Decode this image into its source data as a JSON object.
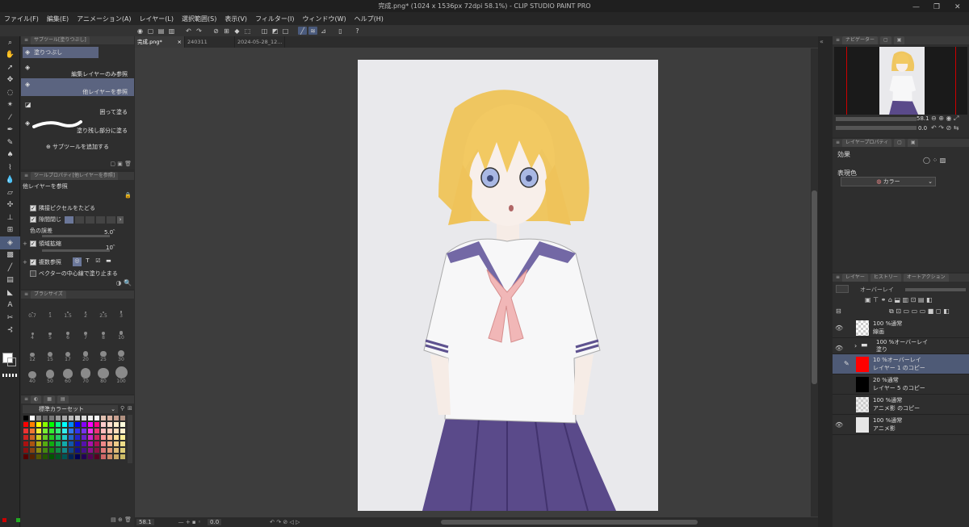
{
  "window": {
    "title": "完成.png* (1024 x 1536px 72dpi 58.1%) - CLIP STUDIO PAINT PRO",
    "min": "—",
    "max": "❐",
    "close": "✕"
  },
  "menu": [
    "ファイル(F)",
    "編集(E)",
    "アニメーション(A)",
    "レイヤー(L)",
    "選択範囲(S)",
    "表示(V)",
    "フィルター(I)",
    "ウィンドウ(W)",
    "ヘルプ(H)"
  ],
  "doc_tabs": [
    {
      "label": "完成.png*",
      "active": true
    },
    {
      "label": "240311",
      "active": false
    },
    {
      "label": "2024-05-28_12...",
      "active": false
    }
  ],
  "subtool": {
    "tab": "サブツール[塗りつぶし]",
    "group_label": "塗りつぶし",
    "items": [
      "編集レイヤーのみ参照",
      "他レイヤーを参照",
      "囲って塗る",
      "塗り残し部分に塗る"
    ],
    "add_label": "サブツールを追加する"
  },
  "toolprop": {
    "tab": "ツールプロパティ[他レイヤーを参照]",
    "title": "他レイヤーを参照",
    "rows": [
      {
        "label": "隣接ピクセルをたどる",
        "checked": true
      },
      {
        "label": "隙間閉じ",
        "checked": true
      },
      {
        "label": "色の誤差",
        "value": "5.0"
      },
      {
        "label": "領域拡縮",
        "checked": true,
        "value": "10"
      },
      {
        "label": "複数参照",
        "checked": true
      },
      {
        "label": "ベクターの中心線で塗り止まる",
        "checked": false
      }
    ]
  },
  "brushsize": {
    "tab": "ブラシサイズ",
    "sizes": [
      "0.7",
      "1",
      "1.5",
      "2",
      "2.5",
      "3",
      "4",
      "5",
      "6",
      "7",
      "8",
      "10",
      "12",
      "15",
      "17",
      "20",
      "25",
      "30",
      "40",
      "50",
      "60",
      "70",
      "80",
      "100"
    ]
  },
  "colorset": {
    "name": "標準カラーセット"
  },
  "navigator": {
    "tab": "ナビゲーター",
    "zoom": "58.1",
    "angle": "0.0"
  },
  "layerprop": {
    "tab": "レイヤープロパティ",
    "effect_label": "効果",
    "expression_label": "表現色",
    "expression_value": "カラー"
  },
  "layers": {
    "tabs": [
      "レイヤー",
      "ヒストリー",
      "オートアクション"
    ],
    "blend_mode": "オーバーレイ",
    "rows": [
      {
        "mode": "100 %通常",
        "name": "線画",
        "visible": true,
        "thumb": "#dcdcdc"
      },
      {
        "mode": "100 %オーバーレイ",
        "name": "塗り",
        "visible": true,
        "thumb": "folder"
      },
      {
        "mode": "10 %オーバーレイ",
        "name": "レイヤー 1 のコピー",
        "visible": false,
        "thumb": "#ff0000",
        "selected": true
      },
      {
        "mode": "20 %通常",
        "name": "レイヤー 5 のコピー",
        "visible": false,
        "thumb": "#000000"
      },
      {
        "mode": "100 %通常",
        "name": "アニメ影 のコピー",
        "visible": false,
        "thumb": "#d8d8d8"
      },
      {
        "mode": "100 %通常",
        "name": "アニメ影",
        "visible": true,
        "thumb": "#e6e6e6"
      }
    ]
  },
  "status": {
    "zoom": "58.1",
    "angle": "0.0"
  },
  "colors": {
    "accent": "#4d5b7a",
    "selected_row": "#4e5a76",
    "hair": "#f2c85a",
    "skirt": "#5b4a8c",
    "collar": "#7a6fa8",
    "scarf": "#f0b8b8"
  }
}
